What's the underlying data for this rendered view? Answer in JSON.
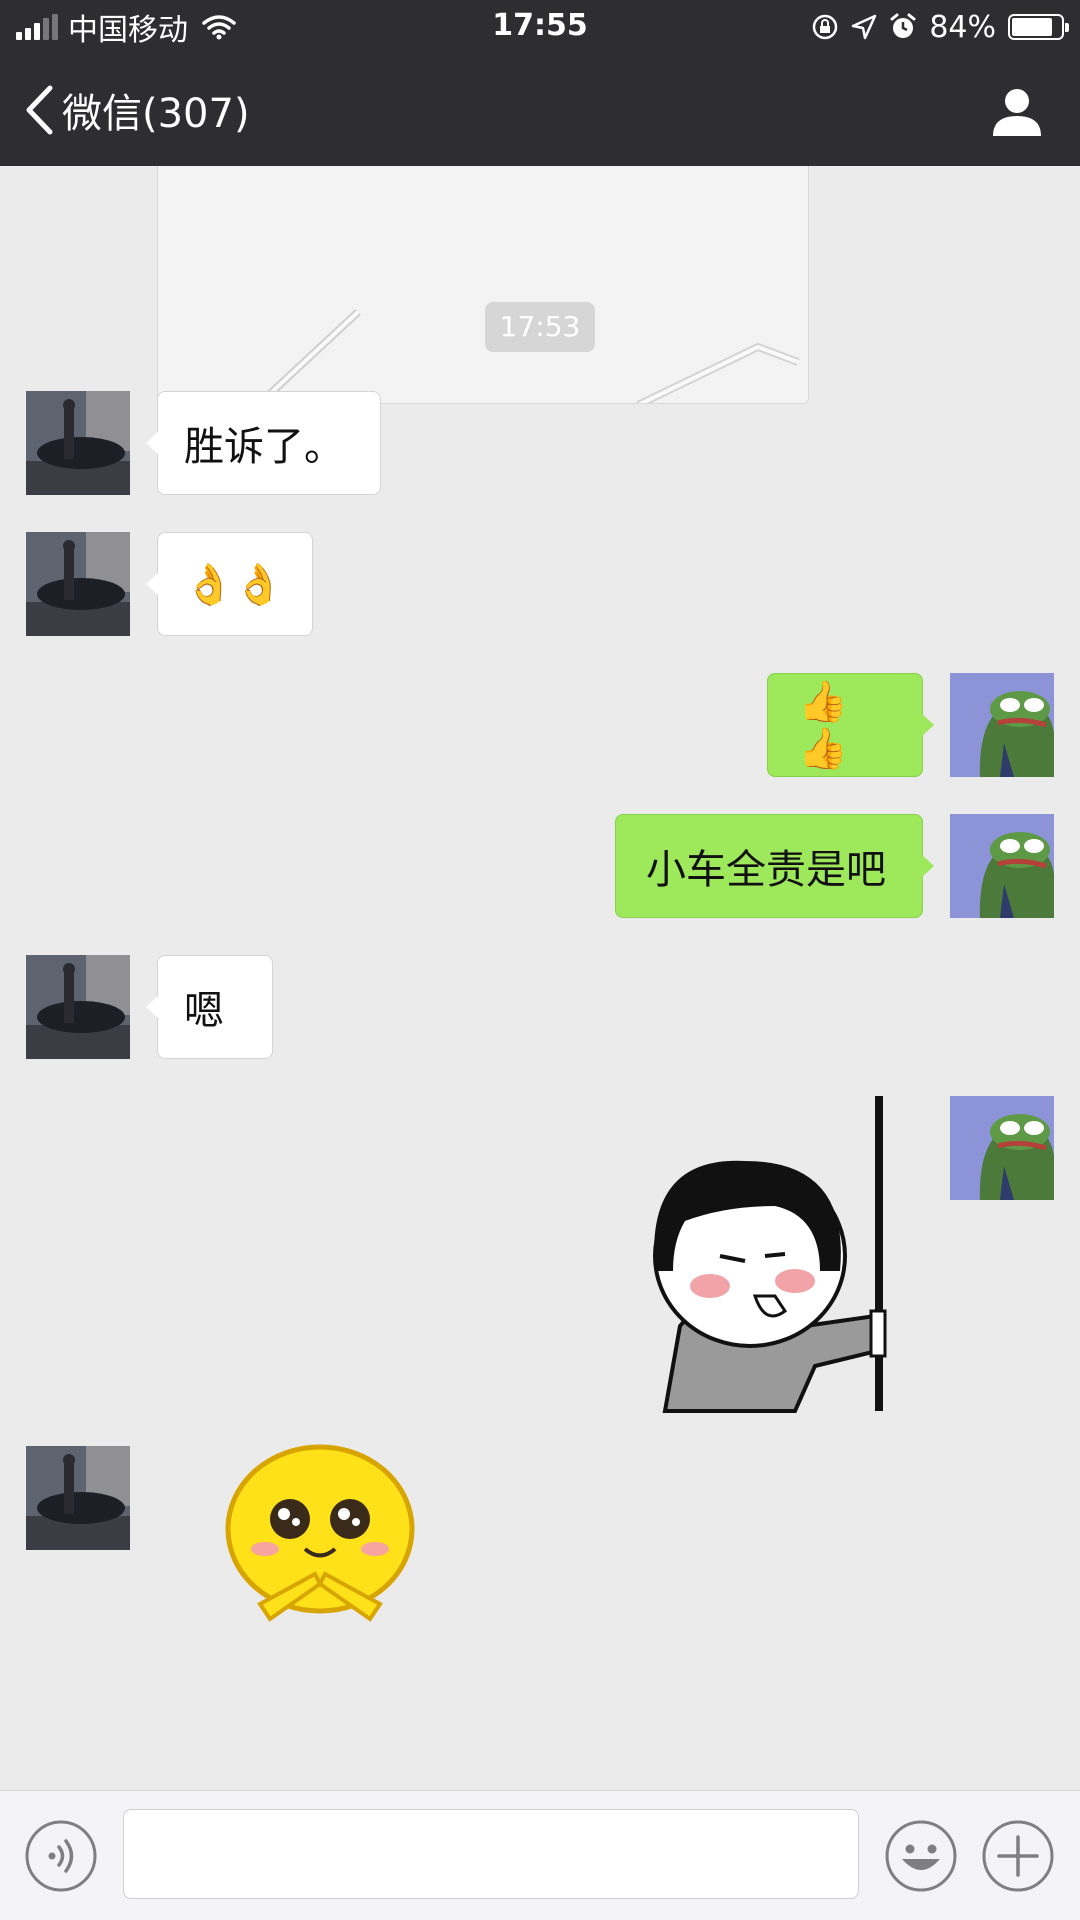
{
  "status_bar": {
    "carrier": "中国移动",
    "time": "17:55",
    "battery": "84%",
    "battery_level": 0.84,
    "icons": [
      "signal-icon",
      "wifi-icon",
      "rotation-lock-icon",
      "location-icon",
      "alarm-icon",
      "battery-icon"
    ]
  },
  "nav": {
    "back_label": "微信(307)",
    "right_icon": "person-icon"
  },
  "chat": {
    "timestamp": "17:53",
    "messages": [
      {
        "side": "in",
        "type": "text",
        "text": "胜诉了。"
      },
      {
        "side": "in",
        "type": "emoji",
        "text": "👌👌"
      },
      {
        "side": "out",
        "type": "emoji",
        "text": "👍👍"
      },
      {
        "side": "out",
        "type": "text",
        "text": "小车全责是吧"
      },
      {
        "side": "in",
        "type": "text",
        "text": "嗯"
      },
      {
        "side": "out",
        "type": "sticker",
        "sticker": "bowl-cut-girl-peeking-sticker"
      },
      {
        "side": "in",
        "type": "sticker",
        "sticker": "yellow-smiley-please-sticker"
      }
    ]
  },
  "input_bar": {
    "placeholder": "",
    "icons": [
      "voice-icon",
      "emoji-icon",
      "plus-icon"
    ]
  },
  "colors": {
    "bar_bg": "#2e2e31",
    "chat_bg": "#ebebeb",
    "out_bubble": "#9de85b",
    "in_bubble": "#ffffff"
  }
}
